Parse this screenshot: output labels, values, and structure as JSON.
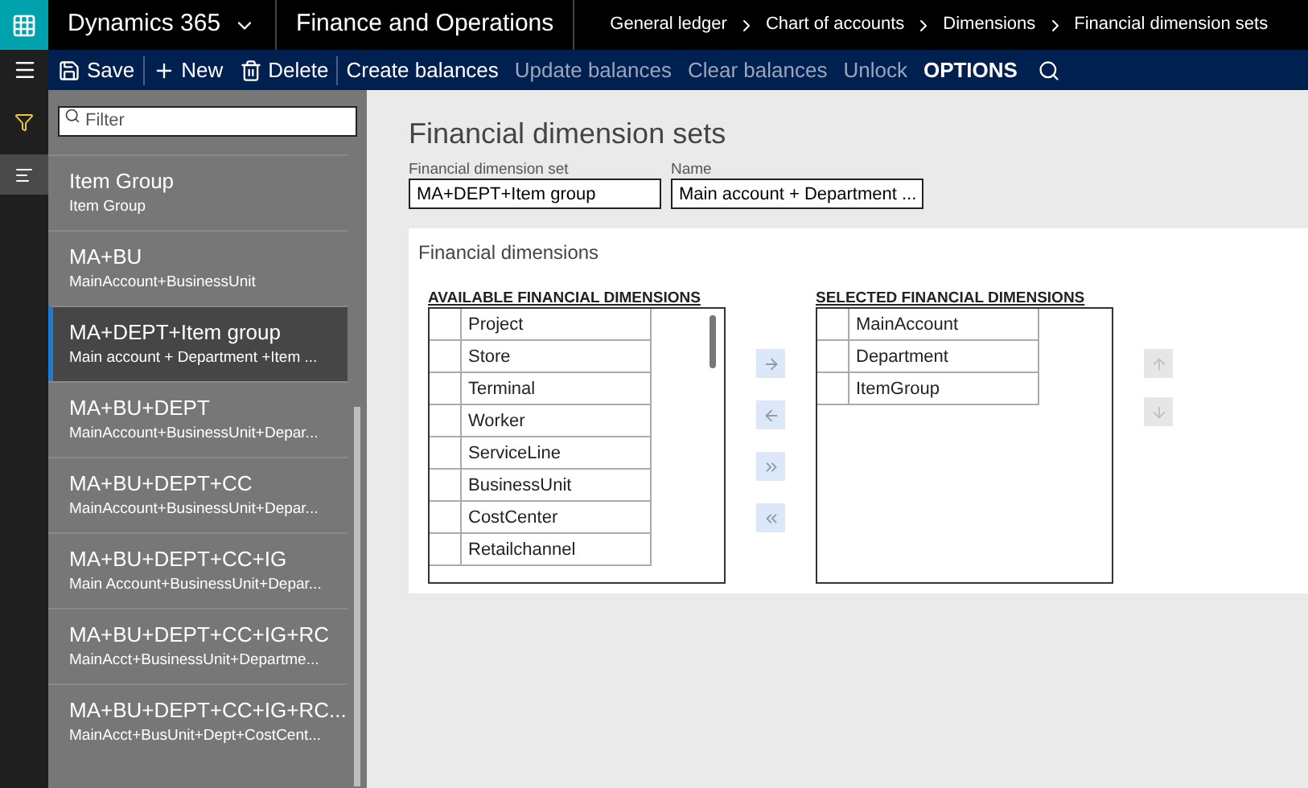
{
  "header": {
    "product": "Dynamics 365",
    "module": "Finance and Operations",
    "breadcrumbs": [
      "General ledger",
      "Chart of accounts",
      "Dimensions",
      "Financial dimension sets"
    ]
  },
  "toolbar": [
    {
      "kind": "save",
      "label": "Save",
      "disabled": false
    },
    {
      "kind": "new",
      "label": "New",
      "disabled": false
    },
    {
      "kind": "delete",
      "label": "Delete",
      "disabled": false
    },
    {
      "kind": "text",
      "label": "Create balances",
      "disabled": false
    },
    {
      "kind": "text",
      "label": "Update balances",
      "disabled": true
    },
    {
      "kind": "text",
      "label": "Clear balances",
      "disabled": true
    },
    {
      "kind": "text",
      "label": "Unlock",
      "disabled": true
    },
    {
      "kind": "options",
      "label": "OPTIONS",
      "disabled": false
    },
    {
      "kind": "search",
      "disabled": false
    }
  ],
  "list": {
    "filter_placeholder": "Filter",
    "items": [
      {
        "title": "Item Group",
        "subtitle": "Item Group",
        "selected": false
      },
      {
        "title": "MA+BU",
        "subtitle": "MainAccount+BusinessUnit",
        "selected": false
      },
      {
        "title": "MA+DEPT+Item group",
        "subtitle": "Main account + Department +Item ...",
        "selected": true
      },
      {
        "title": "MA+BU+DEPT",
        "subtitle": "MainAccount+BusinessUnit+Depar...",
        "selected": false
      },
      {
        "title": "MA+BU+DEPT+CC",
        "subtitle": "MainAccount+BusinessUnit+Depar...",
        "selected": false
      },
      {
        "title": "MA+BU+DEPT+CC+IG",
        "subtitle": "Main Account+BusinessUnit+Depar...",
        "selected": false
      },
      {
        "title": "MA+BU+DEPT+CC+IG+RC",
        "subtitle": "MainAcct+BusinessUnit+Departme...",
        "selected": false
      },
      {
        "title": "MA+BU+DEPT+CC+IG+RC...",
        "subtitle": "MainAcct+BusUnit+Dept+CostCent...",
        "selected": false
      }
    ]
  },
  "page_title": "Financial dimension sets",
  "fields": [
    {
      "label": "Financial dimension set",
      "value": "MA+DEPT+Item group"
    },
    {
      "label": "Name",
      "value": "Main account + Department ..."
    }
  ],
  "section": {
    "title": "Financial dimensions",
    "available": {
      "heading": "AVAILABLE FINANCIAL DIMENSIONS",
      "rows": [
        "Project",
        "Store",
        "Terminal",
        "Worker",
        "ServiceLine",
        "BusinessUnit",
        "CostCenter",
        "Retailchannel"
      ]
    },
    "move_buttons": [
      {
        "kind": "add",
        "disabled": false
      },
      {
        "kind": "remove",
        "disabled": false
      },
      {
        "kind": "add_all",
        "disabled": false
      },
      {
        "kind": "remove_all",
        "disabled": false
      }
    ],
    "selected": {
      "heading": "SELECTED FINANCIAL DIMENSIONS",
      "rows": [
        "MainAccount",
        "Department",
        "ItemGroup"
      ]
    },
    "order_buttons": [
      {
        "kind": "up",
        "disabled": true
      },
      {
        "kind": "down",
        "disabled": true
      }
    ]
  }
}
